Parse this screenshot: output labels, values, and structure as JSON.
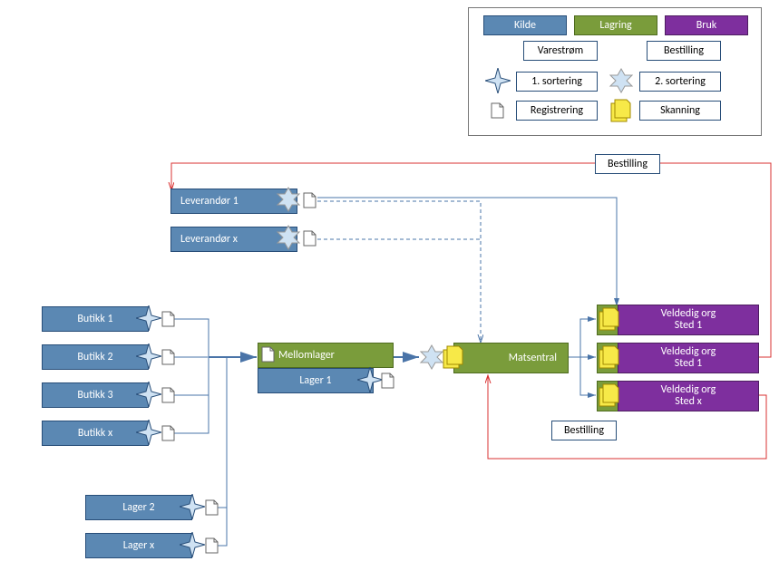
{
  "legend": {
    "kilde": "Kilde",
    "lagring": "Lagring",
    "bruk": "Bruk",
    "varestrom": "Varestrøm",
    "bestilling": "Bestilling",
    "sort1": "1. sortering",
    "sort2": "2. sortering",
    "registrering": "Registrering",
    "skanning": "Skanning"
  },
  "leverandor": {
    "l1": "Leverandør 1",
    "lx": "Leverandør x"
  },
  "butikk": {
    "b1": "Butikk 1",
    "b2": "Butikk 2",
    "b3": "Butikk 3",
    "bx": "Butikk x"
  },
  "lager": {
    "mellom": "Mellomlager",
    "l1": "Lager 1",
    "l2": "Lager 2",
    "lx": "Lager x"
  },
  "matsentral": "Matsentral",
  "veldedig": {
    "line1": "Veldedig org",
    "v1": "Sted 1",
    "v2": "Sted 1",
    "vx": "Sted x"
  },
  "label_bestilling": "Bestilling",
  "colors": {
    "kilde": "#5b88b3",
    "kilde_border": "#274d78",
    "lagring": "#7a9c3b",
    "bruk": "#7e2f9e",
    "red": "#d93030",
    "blue_arrow": "#4a74a8"
  }
}
